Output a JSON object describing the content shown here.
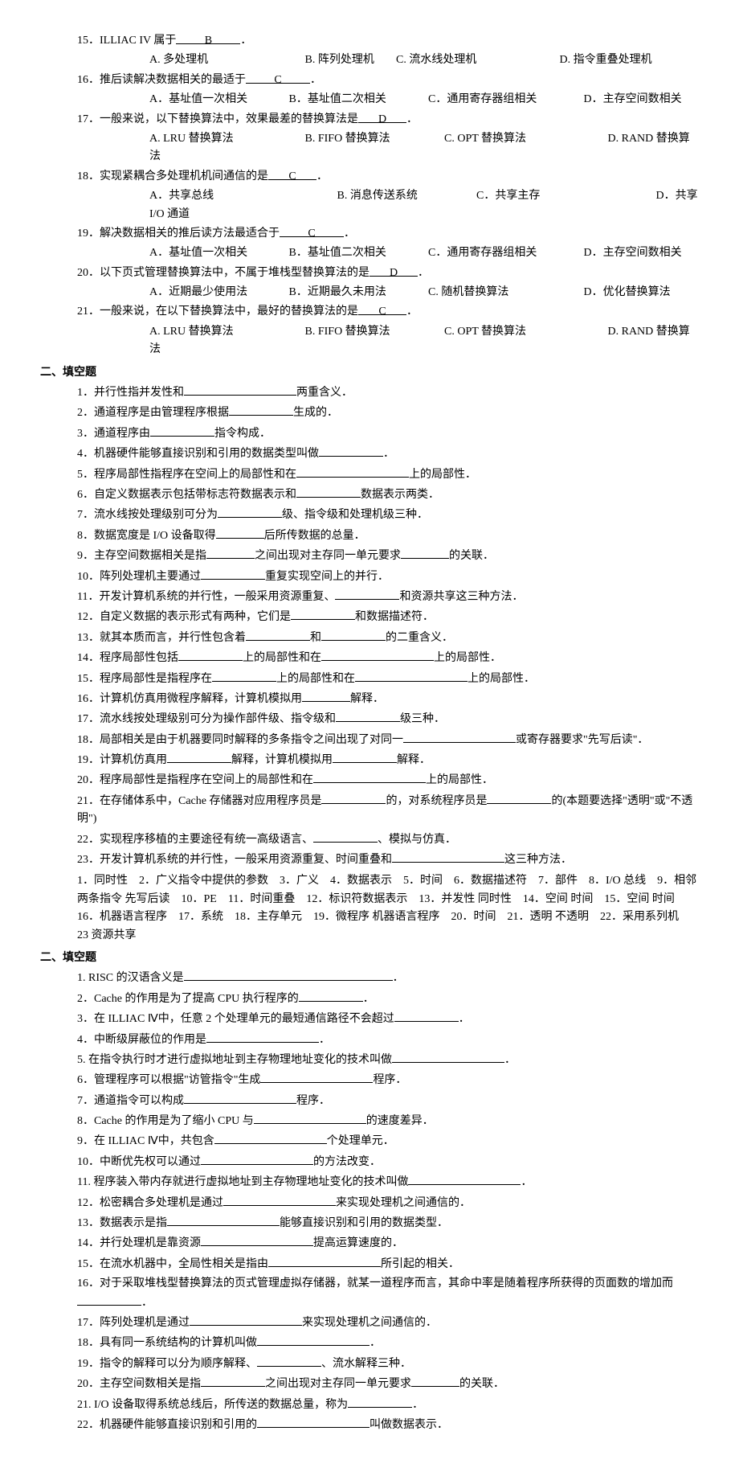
{
  "mc": {
    "q15": {
      "stem_a": "15．ILLIAC IV 属于",
      "ans": "B",
      "tail": "．",
      "optA": "A. 多处理机",
      "optB": "B. 阵列处理机",
      "optC": "C. 流水线处理机",
      "optD": "D. 指令重叠处理机"
    },
    "q16": {
      "stem_a": "16．推后读解决数据相关的最适于",
      "ans": "C",
      "tail": "．",
      "optA": "A．基址值一次相关",
      "optB": "B．基址值二次相关",
      "optC": "C．通用寄存器组相关",
      "optD": "D．主存空间数相关"
    },
    "q17": {
      "stem_a": "17．一般来说，以下替换算法中，效果最差的替换算法是",
      "ans": "D",
      "tail": "．",
      "optA": "A. LRU 替换算法",
      "optB": "B. FIFO 替换算法",
      "optC": "C. OPT 替换算法",
      "optD": "D. RAND 替换算法"
    },
    "q18": {
      "stem_a": "18．实现紧耦合多处理机机间通信的是",
      "ans": "C",
      "tail": "．",
      "optA": "A．共享总线",
      "optB": "B. 消息传送系统",
      "optC": "C．共享主存",
      "optD": "D．共享 I/O 通道"
    },
    "q19": {
      "stem_a": "19．解决数据相关的推后读方法最适合于",
      "ans": "C",
      "tail": "．",
      "optA": "A．基址值一次相关",
      "optB": "B．基址值二次相关",
      "optC": "C．通用寄存器组相关",
      "optD": "D．主存空间数相关"
    },
    "q20": {
      "stem_a": "20．以下页式管理替换算法中，不属于堆栈型替换算法的是",
      "ans": "D",
      "tail": "．",
      "optA": "A．近期最少使用法",
      "optB": "B．近期最久未用法",
      "optC": "C. 随机替换算法",
      "optD": "D．优化替换算法"
    },
    "q21": {
      "stem_a": "21．一般来说，在以下替换算法中，最好的替换算法的是",
      "ans": "C",
      "tail": "．",
      "optA": "A. LRU 替换算法",
      "optB": "B. FIFO 替换算法",
      "optC": "C. OPT 替换算法",
      "optD": "D. RAND 替换算法"
    }
  },
  "sec1_title": "二、填空题",
  "fill1": {
    "q1": {
      "a": "1．并行性指并发性和",
      "b": "两重含义．"
    },
    "q2": {
      "a": "2．通道程序是由管理程序根据",
      "b": "生成的．"
    },
    "q3": {
      "a": "3．通道程序由",
      "b": "指令构成．"
    },
    "q4": {
      "a": "4．机器硬件能够直接识别和引用的数据类型叫做",
      "b": "．"
    },
    "q5": {
      "a": "5．程序局部性指程序在空间上的局部性和在",
      "b": "上的局部性．"
    },
    "q6": {
      "a": "6．自定义数据表示包括带标志符数据表示和",
      "b": "数据表示两类．"
    },
    "q7": {
      "a": "7．流水线按处理级别可分为",
      "b": "级、指令级和处理机级三种．"
    },
    "q8": {
      "a": "8．数据宽度是 I/O 设备取得",
      "b": "后所传数据的总量．"
    },
    "q9": {
      "a": "9．主存空间数据相关是指",
      "b": "之间出现对主存同一单元要求",
      "c": "的关联．"
    },
    "q10": {
      "a": "10．阵列处理机主要通过",
      "b": "重复实现空间上的并行．"
    },
    "q11": {
      "a": "11．开发计算机系统的并行性，一般采用资源重复、",
      "b": "和资源共享这三种方法．"
    },
    "q12": {
      "a": "12．自定义数据的表示形式有两种，它们是",
      "b": "和数据描述符．"
    },
    "q13": {
      "a": "13．就其本质而言，并行性包含着",
      "b": "和",
      "c": "的二重含义．"
    },
    "q14": {
      "a": "14．程序局部性包括",
      "b": "上的局部性和在",
      "c": "上的局部性．"
    },
    "q15": {
      "a": "15．程序局部性是指程序在",
      "b": "上的局部性和在",
      "c": "上的局部性．"
    },
    "q16": {
      "a": "16．计算机仿真用微程序解释，计算机模拟用",
      "b": "解释．"
    },
    "q17": {
      "a": "17．流水线按处理级别可分为操作部件级、指令级和",
      "b": "级三种．"
    },
    "q18": {
      "a": "18．局部相关是由于机器要同时解释的多条指令之间出现了对同一",
      "b": "或寄存器要求\"先写后读\"．"
    },
    "q19": {
      "a": "19．计算机仿真用",
      "b": "解释，计算机模拟用",
      "c": "解释．"
    },
    "q20": {
      "a": "20．程序局部性是指程序在空间上的局部性和在",
      "b": "上的局部性．"
    },
    "q21": {
      "a": "21．在存储体系中，Cache 存储器对应用程序员是",
      "b": "的，对系统程序员是",
      "c": "的(本题要选择\"透明\"或\"不透明\")"
    },
    "q22": {
      "a": "22．实现程序移植的主要途径有统一高级语言、",
      "b": "、模拟与仿真．"
    },
    "q23": {
      "a": "23．开发计算机系统的并行性，一般采用资源重复、时间重叠和",
      "b": "这三种方法．"
    }
  },
  "answers_line1": "1．同时性　2．广义指令中提供的参数　3．广义　4．数据表示　5．时间　6．数据描述符　7．部件　8．I/O 总线　9．相邻两条指令  先写后读　10．PE　11．时间重叠　12．标识符数据表示　13．并发性  同时性　14．空间  时间　15．空间  时间　16．机器语言程序　17．系统　18．主存单元　19．微程序  机器语言程序　20．时间　21．透明  不透明　22．采用系列机　23  资源共享",
  "sec2_title": "二、填空题",
  "fill2": {
    "q1": {
      "a": "1. RISC 的汉语含义是",
      "b": "．"
    },
    "q2": {
      "a": "2．Cache 的作用是为了提高 CPU 执行程序的",
      "b": "．"
    },
    "q3": {
      "a": "3．在 ILLIAC  Ⅳ中，任意 2 个处理单元的最短通信路径不会超过",
      "b": "．"
    },
    "q4": {
      "a": "4．中断级屏蔽位的作用是",
      "b": "．"
    },
    "q5": {
      "a": "5. 在指令执行时才进行虚拟地址到主存物理地址变化的技术叫做",
      "b": "．"
    },
    "q6": {
      "a": "6．管理程序可以根据\"访管指令\"生成",
      "b": "程序．"
    },
    "q7": {
      "a": "7．通道指令可以构成",
      "b": "程序．"
    },
    "q8": {
      "a": "8．Cache 的作用是为了缩小 CPU 与",
      "b": "的速度差异．"
    },
    "q9": {
      "a": "9．在 ILLIAC  Ⅳ中，共包含",
      "b": "个处理单元．"
    },
    "q10": {
      "a": "10．中断优先权可以通过",
      "b": "的方法改变．"
    },
    "q11": {
      "a": "11. 程序装入带内存就进行虚拟地址到主存物理地址变化的技术叫做",
      "b": "．"
    },
    "q12": {
      "a": "12．松密耦合多处理机是通过",
      "b": "来实现处理机之间通信的．"
    },
    "q13": {
      "a": "13．数据表示是指",
      "b": "能够直接识别和引用的数据类型．"
    },
    "q14": {
      "a": "14．并行处理机是靠资源",
      "b": "提高运算速度的．"
    },
    "q15": {
      "a": "15．在流水机器中，全局性相关是指由",
      "b": "所引起的相关．"
    },
    "q16": {
      "a": "16．对于采取堆栈型替换算法的页式管理虚拟存储器，就某一道程序而言，其命中率是随着程序所获得的页面数的增加而",
      "b": "．"
    },
    "q17": {
      "a": "17．阵列处理机是通过",
      "b": "来实现处理机之间通信的．"
    },
    "q18": {
      "a": "18．具有同一系统结构的计算机叫做",
      "b": "．"
    },
    "q19": {
      "a": "19．指令的解释可以分为顺序解释、",
      "b": "、流水解释三种．"
    },
    "q20": {
      "a": "20．主存空间数相关是指",
      "b": "之间出现对主存同一单元要求",
      "c": "的关联．"
    },
    "q21": {
      "a": "21. I/O 设备取得系统总线后，所传送的数据总量，称为",
      "b": "．"
    },
    "q22": {
      "a": "22．机器硬件能够直接识别和引用的",
      "b": "叫做数据表示．"
    }
  }
}
